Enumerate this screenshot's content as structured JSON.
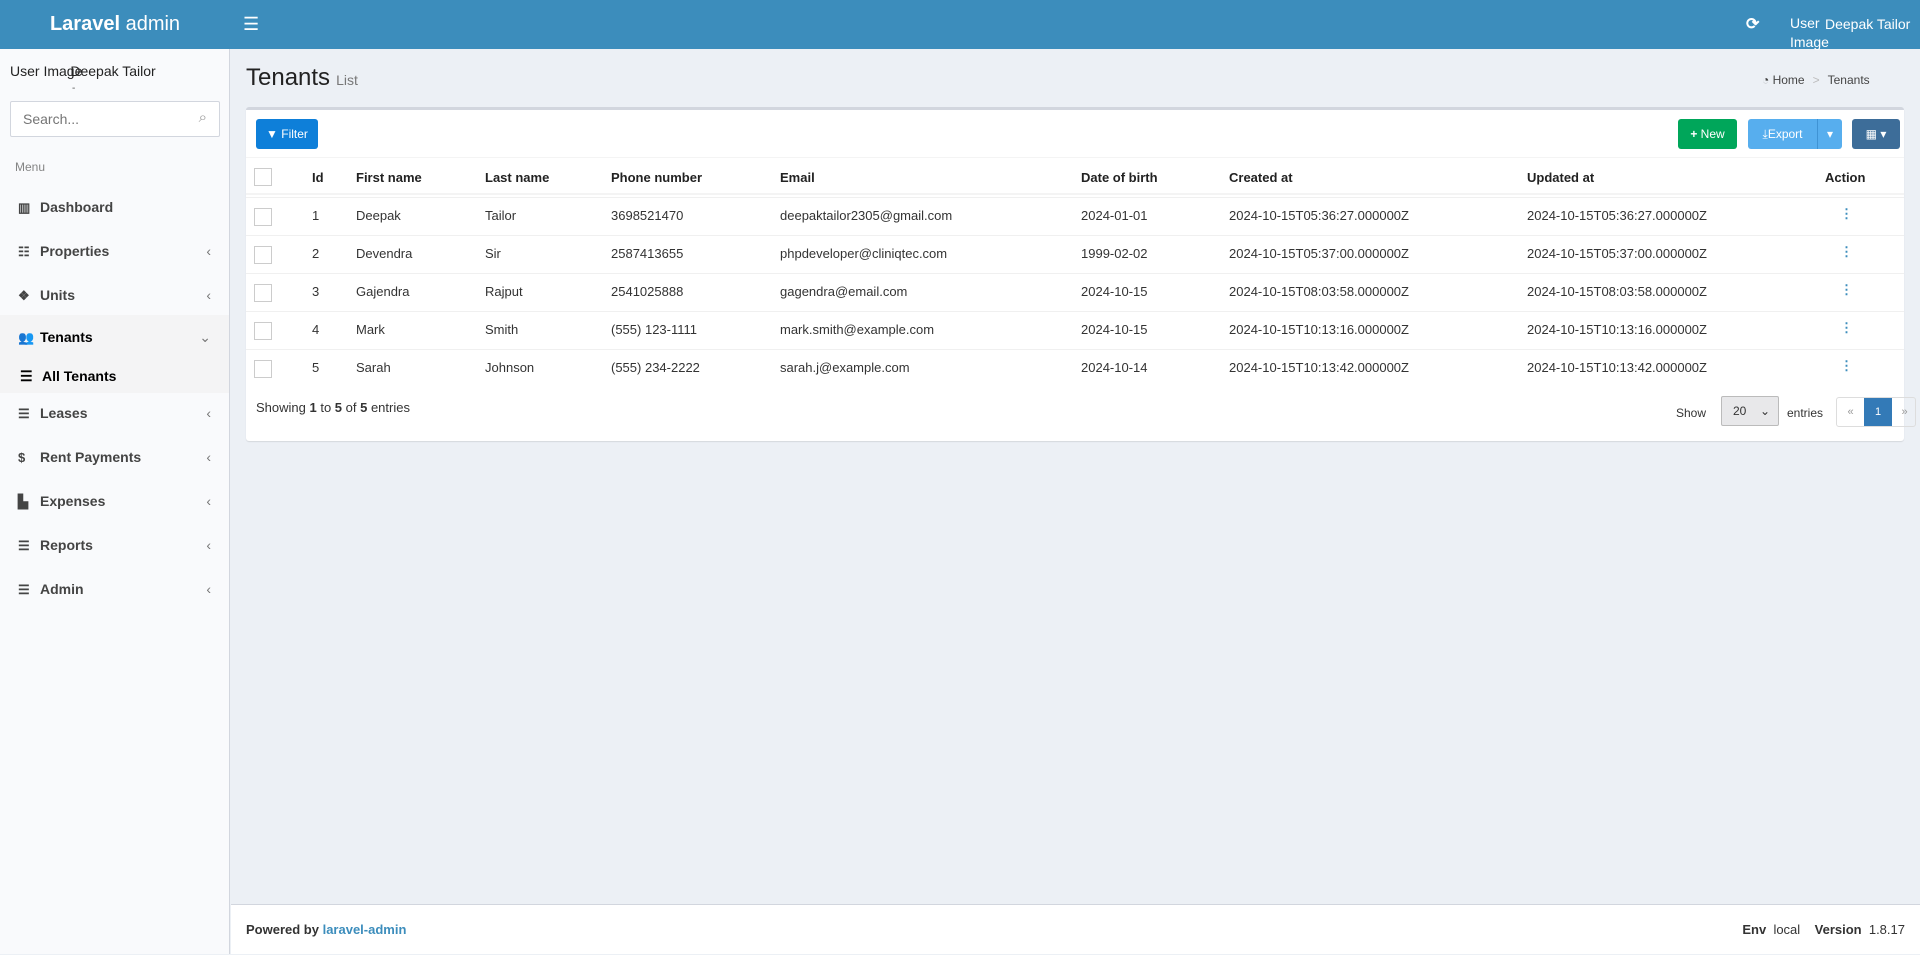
{
  "header": {
    "logo_bold": "Laravel",
    "logo_light": " admin",
    "user_image_alt": "User Image",
    "user_name": "Deepak Tailor"
  },
  "sidebar": {
    "user_image_alt": "User Image",
    "user_name": "Deepak Tailor",
    "status": "-",
    "search_placeholder": "Search...",
    "menu_header": "Menu",
    "items": [
      {
        "label": "Dashboard",
        "icon": "bar-chart-icon"
      },
      {
        "label": "Properties",
        "icon": "list-icon"
      },
      {
        "label": "Units",
        "icon": "cubes-icon"
      },
      {
        "label": "Tenants",
        "icon": "users-icon"
      },
      {
        "label": "Leases",
        "icon": "server-icon"
      },
      {
        "label": "Rent Payments",
        "icon": "dollar-icon"
      },
      {
        "label": "Expenses",
        "icon": "file-icon"
      },
      {
        "label": "Reports",
        "icon": "bars-icon"
      },
      {
        "label": "Admin",
        "icon": "tasks-icon"
      }
    ],
    "subitem": "All Tenants"
  },
  "page": {
    "title": "Tenants",
    "subtitle": "List",
    "breadcrumb": [
      "Home",
      "Tenants"
    ]
  },
  "toolbar": {
    "filter": "Filter",
    "new": "New",
    "export": "Export"
  },
  "table": {
    "columns": [
      "Id",
      "First name",
      "Last name",
      "Phone number",
      "Email",
      "Date of birth",
      "Created at",
      "Updated at",
      "Action"
    ],
    "rows": [
      [
        "1",
        "Deepak",
        "Tailor",
        "3698521470",
        "deepaktailor2305@gmail.com",
        "2024-01-01",
        "2024-10-15T05:36:27.000000Z",
        "2024-10-15T05:36:27.000000Z"
      ],
      [
        "2",
        "Devendra",
        "Sir",
        "2587413655",
        "phpdeveloper@cliniqtec.com",
        "1999-02-02",
        "2024-10-15T05:37:00.000000Z",
        "2024-10-15T05:37:00.000000Z"
      ],
      [
        "3",
        "Gajendra",
        "Rajput",
        "2541025888",
        "gagendra@email.com",
        "2024-10-15",
        "2024-10-15T08:03:58.000000Z",
        "2024-10-15T08:03:58.000000Z"
      ],
      [
        "4",
        "Mark",
        "Smith",
        "(555) 123-1111",
        "mark.smith@example.com",
        "2024-10-15",
        "2024-10-15T10:13:16.000000Z",
        "2024-10-15T10:13:16.000000Z"
      ],
      [
        "5",
        "Sarah",
        "Johnson",
        "(555) 234-2222",
        "sarah.j@example.com",
        "2024-10-14",
        "2024-10-15T10:13:42.000000Z",
        "2024-10-15T10:13:42.000000Z"
      ]
    ]
  },
  "pagination": {
    "showing_prefix": "Showing ",
    "from": "1",
    "to_word": " to ",
    "to": "5",
    "of_word": " of ",
    "total": "5",
    "suffix": " entries",
    "show": "Show",
    "per_page": "20",
    "entries": "entries",
    "prev": "«",
    "page": "1",
    "next": "»"
  },
  "footer": {
    "powered": "Powered by ",
    "link": "laravel-admin",
    "env_label": "Env",
    "env": "local",
    "version_label": "Version",
    "version": "1.8.17"
  },
  "colors": {
    "header": "#3c8dbc",
    "new": "#00a65a",
    "filter": "#0e7fd9",
    "export": "#57aeee",
    "columns": "#3d6d99"
  }
}
